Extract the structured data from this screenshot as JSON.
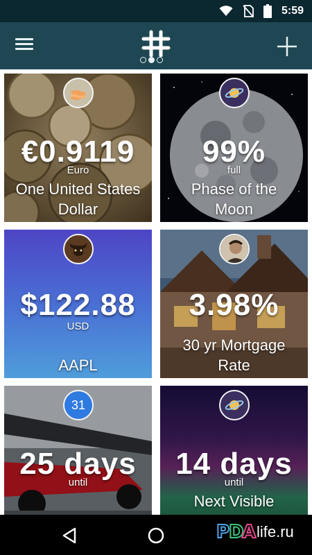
{
  "status_bar": {
    "time": "5:59"
  },
  "app_bar": {
    "menu_icon": "hamburger-icon",
    "logo_icon": "hash-logo-icon",
    "add_icon": "plus-icon",
    "page_dots": 3,
    "active_page": 1
  },
  "tiles": [
    {
      "value": "€0.9119",
      "unit": "Euro",
      "title": "One United States Dollar",
      "badge_icon": "coins-icon"
    },
    {
      "value": "99%",
      "unit": "full",
      "title": "Phase of the Moon",
      "badge_icon": "saturn-icon"
    },
    {
      "value": "$122.88",
      "unit": "USD",
      "title": "AAPL",
      "badge_icon": "bull-icon"
    },
    {
      "value": "3.98%",
      "unit": "",
      "title": "30 yr Mortgage Rate",
      "badge_icon": "person-avatar-icon"
    },
    {
      "value": "25 days",
      "unit": "until",
      "title": "",
      "badge_icon": "calendar-icon",
      "badge_text": "31"
    },
    {
      "value": "14 days",
      "unit": "until",
      "title": "Next Visible",
      "badge_icon": "saturn-icon"
    }
  ],
  "watermark": {
    "brand": "PDA",
    "suffix": "life.ru"
  },
  "nav_bar": {
    "back_icon": "back-triangle-icon",
    "home_icon": "home-circle-icon"
  }
}
